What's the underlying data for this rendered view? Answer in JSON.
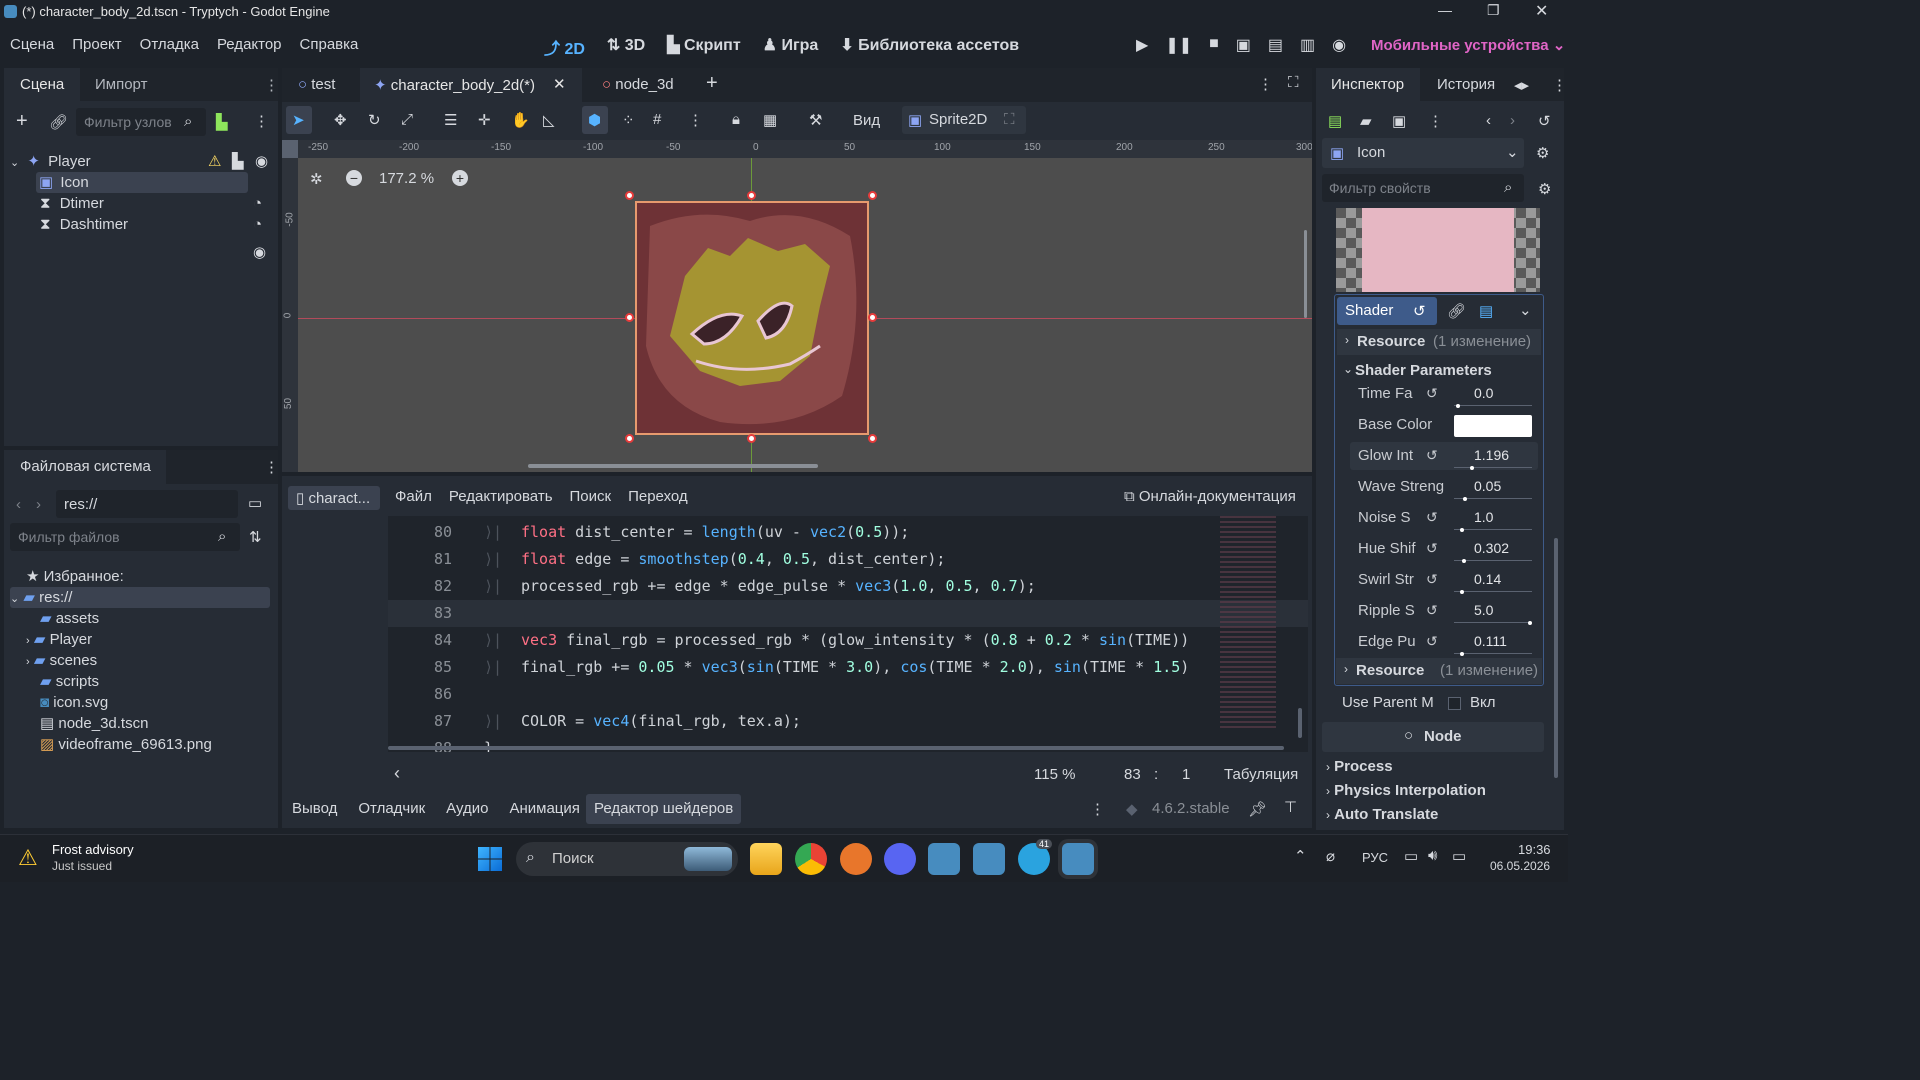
{
  "window": {
    "title": "(*) character_body_2d.tscn - Tryptych - Godot Engine"
  },
  "menu": [
    "Сцена",
    "Проект",
    "Отладка",
    "Редактор",
    "Справка"
  ],
  "workspaces": [
    "2D",
    "3D",
    "Скрипт",
    "Игра",
    "Библиотека ассетов"
  ],
  "renderer": "Мобильные устройства",
  "scene_dock": {
    "tabs": [
      "Сцена",
      "Импорт"
    ],
    "filter_placeholder": "Фильтр узлов",
    "nodes": [
      {
        "name": "Player"
      },
      {
        "name": "Icon"
      },
      {
        "name": "Dtimer"
      },
      {
        "name": "Dashtimer"
      }
    ]
  },
  "editor_tabs": [
    "test",
    "character_body_2d(*)",
    "node_3d"
  ],
  "toolbar": {
    "view_label": "Вид",
    "node_type": "Sprite2D",
    "zoom": "177.2 %"
  },
  "ruler": {
    "h": [
      "-250",
      "-200",
      "-150",
      "-100",
      "-50",
      "0",
      "50",
      "100",
      "150",
      "200",
      "250",
      "300"
    ],
    "v": [
      "-50",
      "0",
      "50"
    ]
  },
  "filesystem": {
    "title": "Файловая система",
    "path": "res://",
    "filter_placeholder": "Фильтр файлов",
    "favorites": "Избранное:",
    "root": "res://",
    "items": [
      "assets",
      "Player",
      "scenes",
      "scripts",
      "icon.svg",
      "node_3d.tscn",
      "videoframe_69613.png"
    ]
  },
  "script_editor": {
    "file_tab": "charact...",
    "menu": [
      "Файл",
      "Редактировать",
      "Поиск",
      "Переход"
    ],
    "online_docs": "Онлайн-документация",
    "zoom": "115 %",
    "line": "83",
    "col": "1",
    "indent": "Табуляция",
    "lines": [
      {
        "n": "80",
        "t": "float dist_center = length(uv - vec2(0.5));"
      },
      {
        "n": "81",
        "t": "float edge = smoothstep(0.4, 0.5, dist_center);"
      },
      {
        "n": "82",
        "t": "processed_rgb += edge * edge_pulse * vec3(1.0, 0.5, 0.7);"
      },
      {
        "n": "83",
        "t": ""
      },
      {
        "n": "84",
        "t": "vec3 final_rgb = processed_rgb * (glow_intensity * (0.8 + 0.2 * sin(TIME))"
      },
      {
        "n": "85",
        "t": "final_rgb += 0.05 * vec3(sin(TIME * 3.0), cos(TIME * 2.0), sin(TIME * 1.5)"
      },
      {
        "n": "86",
        "t": ""
      },
      {
        "n": "87",
        "t": "COLOR = vec4(final_rgb, tex.a);"
      },
      {
        "n": "88",
        "t": "}"
      }
    ]
  },
  "bottom_tabs": [
    "Вывод",
    "Отладчик",
    "Аудио",
    "Анимация",
    "Редактор шейдеров"
  ],
  "version": "4.6.2.stable",
  "inspector": {
    "tabs": [
      "Инспектор",
      "История"
    ],
    "object": "Icon",
    "filter_placeholder": "Фильтр свойств",
    "shader_label": "Shader",
    "resource": "Resource",
    "resource_changes": "(1 изменение)",
    "shader_params": "Shader Parameters",
    "params": [
      {
        "label": "Time Fa",
        "value": "0.0",
        "fill": 0.0
      },
      {
        "label": "Base Color",
        "value": "",
        "fill": 0
      },
      {
        "label": "Glow Int",
        "value": "1.196",
        "fill": 0.2
      },
      {
        "label": "Wave Streng",
        "value": "0.05",
        "fill": 0.1
      },
      {
        "label": "Noise S",
        "value": "1.0",
        "fill": 0.05
      },
      {
        "label": "Hue Shif",
        "value": "0.302",
        "fill": 0.08
      },
      {
        "label": "Swirl Str",
        "value": "0.14",
        "fill": 0.05
      },
      {
        "label": "Ripple S",
        "value": "5.0",
        "fill": 1.0
      },
      {
        "label": "Edge Pu",
        "value": "0.111",
        "fill": 0.05
      }
    ],
    "use_parent": "Use Parent M",
    "use_parent_val": "Вкл",
    "node_header": "Node",
    "sections": [
      "Process",
      "Physics Interpolation",
      "Auto Translate"
    ]
  },
  "notification": {
    "title": "Frost advisory",
    "sub": "Just issued"
  },
  "taskbar": {
    "search": "Поиск",
    "lang": "РУС",
    "time": "19:36",
    "date": "06.05.2026",
    "badge": "41"
  },
  "colors": {
    "accent": "#57b3ff",
    "renderer": "#e065c6"
  }
}
